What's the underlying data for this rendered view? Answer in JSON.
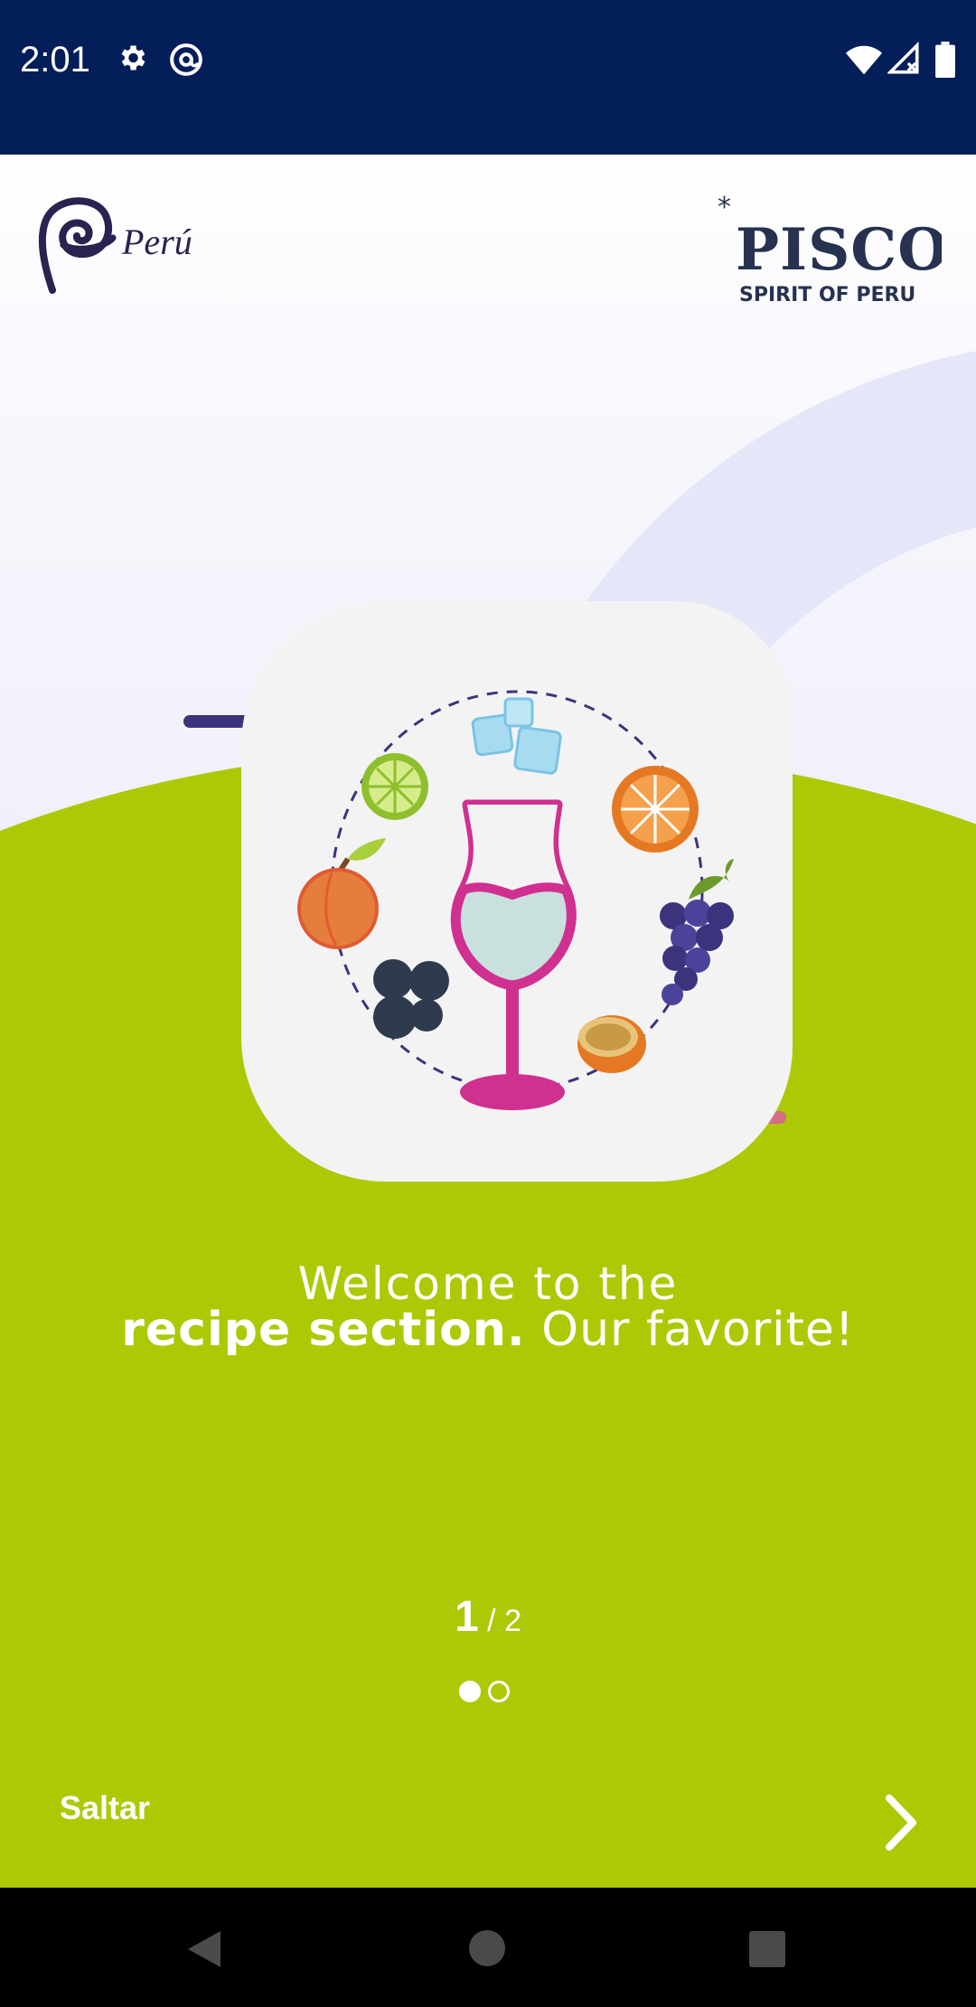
{
  "status_bar": {
    "time": "2:01"
  },
  "header": {
    "logo_left": "Perú",
    "logo_right_main": "PISCO",
    "logo_right_sub": "SPIRIT OF PERU"
  },
  "welcome": {
    "line1": "Welcome to the",
    "line2_bold": "recipe section.",
    "line2_rest": " Our favorite!"
  },
  "pager": {
    "current": "1",
    "separator": " / ",
    "total": "2",
    "active_index": 0
  },
  "footer": {
    "skip_label": "Saltar"
  },
  "colors": {
    "status_bar": "#041e59",
    "green": "#adc906",
    "glass": "#d0308f",
    "arc": "#e6e6f9"
  }
}
